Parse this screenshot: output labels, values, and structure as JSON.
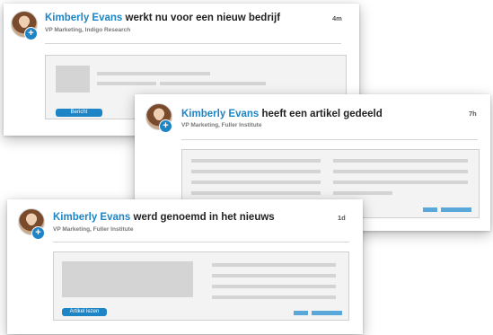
{
  "cards": [
    {
      "name": "Kimberly Evans",
      "action": "werkt nu voor een nieuw bedrijf",
      "subtitle": "VP Marketing, Indigo Research",
      "time": "4m",
      "button_label": "Bericht"
    },
    {
      "name": "Kimberly Evans",
      "action": "heeft een artikel gedeeld",
      "subtitle": "VP Marketing, Fuller Institute",
      "time": "7h"
    },
    {
      "name": "Kimberly Evans",
      "action": "werd genoemd in het nieuws",
      "subtitle": "VP Marketing, Fuller Institute",
      "time": "1d",
      "button_label": "Artikel lezen"
    }
  ],
  "colors": {
    "accent": "#1d84c6",
    "placeholder": "#d4d4d4"
  },
  "icons": {
    "avatar": "profile-photo",
    "follow": "plus-icon"
  }
}
